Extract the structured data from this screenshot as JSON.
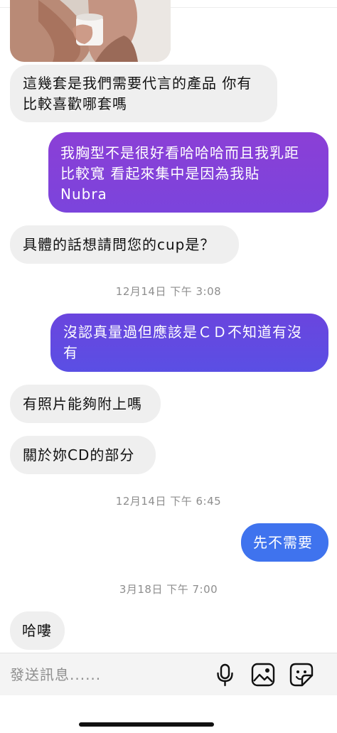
{
  "messages": [
    {
      "dir": "in",
      "lines": [
        "這幾套是我們需要代言的產品 你有",
        "比較喜歡哪套嗎"
      ]
    },
    {
      "dir": "out",
      "lines": [
        "我胸型不是很好看哈哈哈而且我乳距",
        "比較寬 看起來集中是因為我貼",
        "Nubra"
      ]
    },
    {
      "dir": "in",
      "lines": [
        "具體的話想請問您的cup是？"
      ]
    },
    {
      "dir": "out",
      "lines": [
        "沒認真量過但應該是ＣＤ不知道有沒",
        "有"
      ]
    },
    {
      "dir": "in",
      "lines": [
        "有照片能夠附上嗎"
      ]
    },
    {
      "dir": "in",
      "lines": [
        "關於妳CD的部分"
      ]
    },
    {
      "dir": "out",
      "lines": [
        "先不需要"
      ]
    },
    {
      "dir": "in",
      "lines": [
        "哈嘍"
      ]
    }
  ],
  "timestamps": [
    "12月14日 下午 3:08",
    "12月14日 下午 6:45",
    "3月18日 下午 7:00"
  ],
  "composer": {
    "placeholder": "發送訊息......",
    "icons": [
      "microphone-icon",
      "image-icon",
      "sticker-icon"
    ]
  },
  "colors": {
    "received_bubble": "#efefef",
    "sent_gradient_top": "#8b3fd6",
    "sent_gradient_mid": "#6447e0",
    "sent_gradient_bottom": "#3f73ee",
    "timestamp": "#8e8e8e"
  }
}
